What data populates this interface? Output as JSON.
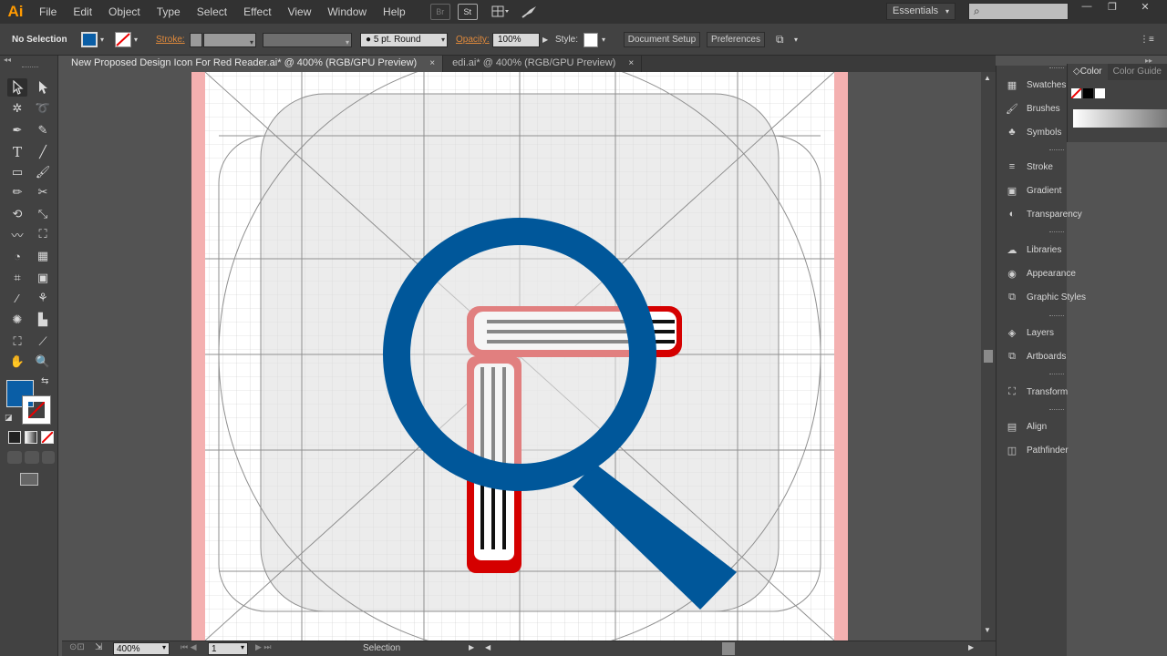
{
  "app": {
    "logo": "Ai",
    "menus": [
      "File",
      "Edit",
      "Object",
      "Type",
      "Select",
      "Effect",
      "View",
      "Window",
      "Help"
    ],
    "workspace": "Essentials",
    "menu_icons": [
      "Br",
      "St"
    ]
  },
  "controlbar": {
    "selection_state": "No Selection",
    "stroke_label": "Stroke:",
    "brush_value": "5 pt. Round",
    "opacity_label": "Opacity:",
    "opacity_value": "100%",
    "style_label": "Style:",
    "document_setup": "Document Setup",
    "preferences": "Preferences"
  },
  "tabs": [
    {
      "label": "New Proposed Design Icon For Red Reader.ai* @ 400% (RGB/GPU Preview)",
      "close": "×"
    },
    {
      "label": "edi.ai* @ 400% (RGB/GPU Preview)",
      "close": "×"
    }
  ],
  "status": {
    "zoom": "400%",
    "page": "1",
    "tool": "Selection"
  },
  "colors": {
    "fill": "#0a5ea6",
    "magnifier": "#00579a",
    "book_red": "#d50000",
    "accent": "#ff9a00"
  },
  "panels": {
    "group1": [
      "Swatches",
      "Brushes",
      "Symbols"
    ],
    "group2": [
      "Stroke",
      "Gradient",
      "Transparency"
    ],
    "group3": [
      "Libraries",
      "Appearance",
      "Graphic Styles"
    ],
    "group4": [
      "Layers",
      "Artboards"
    ],
    "group5": [
      "Transform"
    ],
    "group6": [
      "Align",
      "Pathfinder"
    ],
    "color_tabs": [
      "Color",
      "Color Guide"
    ]
  }
}
